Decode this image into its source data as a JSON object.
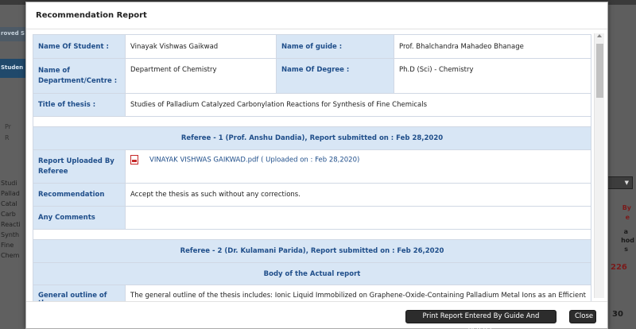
{
  "background": {
    "left_tab1": "roved S",
    "left_tab2": "Studen",
    "left_small": [
      "Pr",
      "R"
    ],
    "left_text": [
      "Studi",
      "Pallad",
      "Catal",
      "Carb",
      "Reacti",
      "Synth",
      "Fine",
      "Chem"
    ],
    "right_red": [
      "By",
      "e"
    ],
    "right_dark": [
      "a",
      "hod",
      "s"
    ],
    "right_num": "226",
    "right_num2": "30"
  },
  "modal": {
    "title": "Recommendation Report",
    "student": {
      "name_label": "Name Of Student :",
      "name_value": "Vinayak Vishwas Gaikwad",
      "guide_label": "Name of guide :",
      "guide_value": "Prof. Bhalchandra Mahadeo Bhanage",
      "dept_label": "Name of Department/Centre :",
      "dept_value": "Department of Chemistry",
      "degree_label": "Name Of Degree :",
      "degree_value": "Ph.D (Sci) - Chemistry",
      "thesis_label": "Title of thesis :",
      "thesis_value": "Studies of Palladium Catalyzed Carbonylation Reactions for Synthesis of Fine Chemicals"
    },
    "referee1": {
      "header": "Referee - 1 (Prof. Anshu Dandia), Report submitted on : Feb 28,2020",
      "report_label": "Report Uploaded By Referee",
      "file_name": "VINAYAK VISHWAS GAIKWAD.pdf",
      "uploaded_on": "( Uploaded on : Feb 28,2020)",
      "recommendation_label": "Recommendation",
      "recommendation_value": "Accept the thesis as such without any corrections.",
      "comments_label": "Any Comments",
      "comments_value": ""
    },
    "referee2": {
      "header": "Referee - 2 (Dr. Kulamani Parida), Report submitted on : Feb 26,2020",
      "body_header": "Body of the Actual report",
      "outline_label": "General outline of the",
      "outline_value": "The general outline of the thesis includes: Ionic Liquid Immobilized on Graphene-Oxide-Containing Palladium Metal Ions as an Efficient"
    },
    "buttons": {
      "print": "Print Report Entered By Guide And Referee",
      "close": "Close"
    }
  },
  "colors": {
    "label_bg": "#d8e6f5",
    "label_text": "#1f4e8a",
    "button_bg": "#2c2c2c"
  }
}
